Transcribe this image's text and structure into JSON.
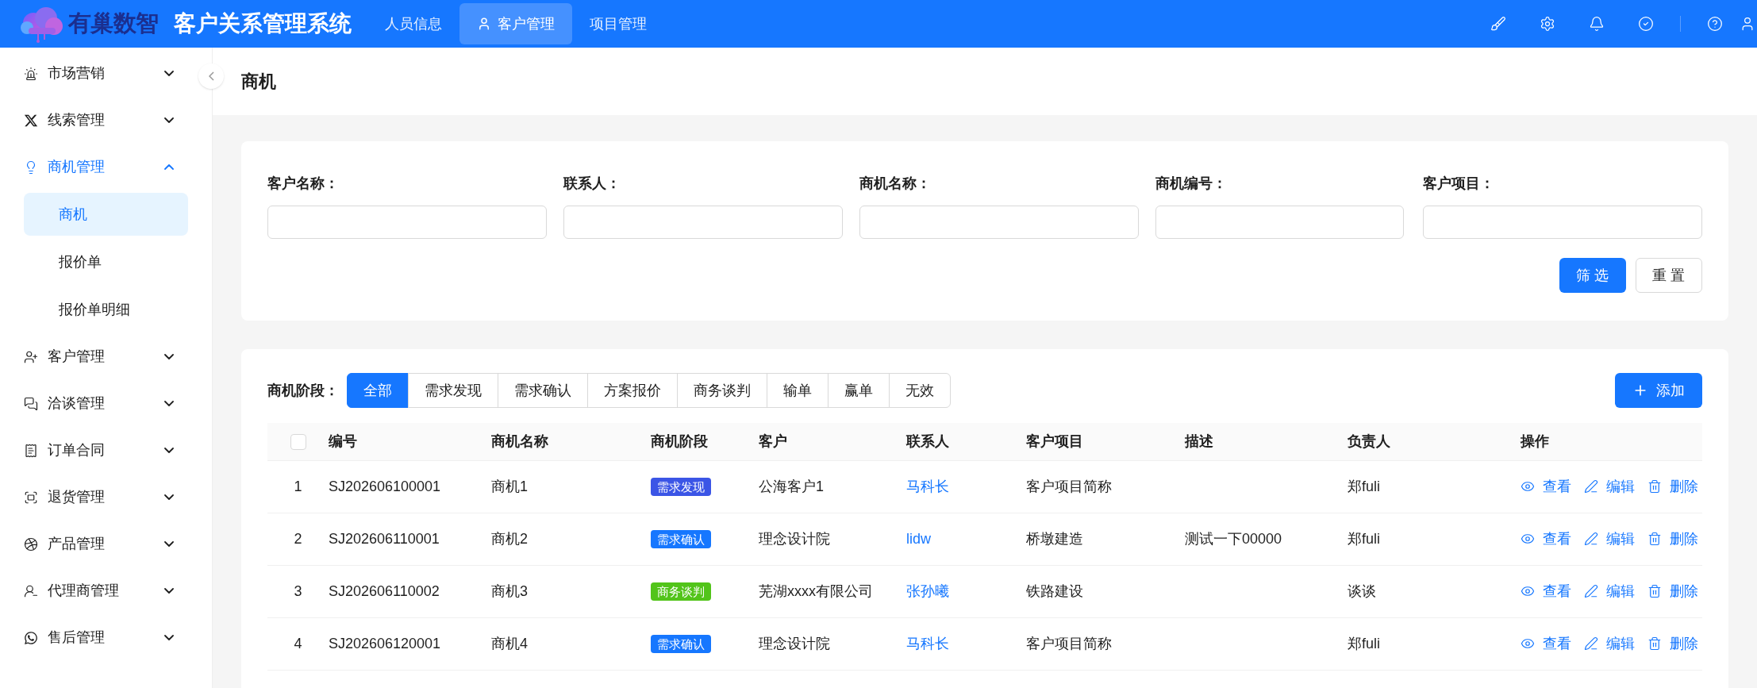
{
  "header": {
    "logo_text": "有巢数智",
    "title": "客户关系管理系统",
    "nav": [
      {
        "label": "人员信息",
        "selected": false
      },
      {
        "label": "客户管理",
        "selected": true
      },
      {
        "label": "项目管理",
        "selected": false
      }
    ]
  },
  "sidebar": {
    "items": [
      {
        "label": "市场营销",
        "expanded": false
      },
      {
        "label": "线索管理",
        "expanded": false
      },
      {
        "label": "商机管理",
        "expanded": true,
        "children": [
          {
            "label": "商机",
            "selected": true
          },
          {
            "label": "报价单",
            "selected": false
          },
          {
            "label": "报价单明细",
            "selected": false
          }
        ]
      },
      {
        "label": "客户管理",
        "expanded": false
      },
      {
        "label": "洽谈管理",
        "expanded": false
      },
      {
        "label": "订单合同",
        "expanded": false
      },
      {
        "label": "退货管理",
        "expanded": false
      },
      {
        "label": "产品管理",
        "expanded": false
      },
      {
        "label": "代理商管理",
        "expanded": false
      },
      {
        "label": "售后管理",
        "expanded": false
      }
    ]
  },
  "page_title": "商机",
  "filters": [
    {
      "label": "客户名称："
    },
    {
      "label": "联系人："
    },
    {
      "label": "商机名称："
    },
    {
      "label": "商机编号："
    },
    {
      "label": "客户项目："
    }
  ],
  "filter_buttons": [
    {
      "label": "筛 选",
      "kind": "primary"
    },
    {
      "label": "重 置",
      "kind": "default"
    }
  ],
  "stage_filter": {
    "label": "商机阶段：",
    "options": [
      {
        "label": "全部",
        "selected": true
      },
      {
        "label": "需求发现",
        "selected": false
      },
      {
        "label": "需求确认",
        "selected": false
      },
      {
        "label": "方案报价",
        "selected": false
      },
      {
        "label": "商务谈判",
        "selected": false
      },
      {
        "label": "输单",
        "selected": false
      },
      {
        "label": "赢单",
        "selected": false
      },
      {
        "label": "无效",
        "selected": false
      }
    ]
  },
  "add_button": "添加",
  "table": {
    "select_all_checked": false,
    "columns": [
      "编号",
      "商机名称",
      "商机阶段",
      "客户",
      "联系人",
      "客户项目",
      "描述",
      "负责人",
      "操作"
    ],
    "rows": [
      {
        "index": "1",
        "code": "SJ202606100001",
        "name": "商机1",
        "stage": "需求发现",
        "color": "#3b55e6",
        "customer": "公海客户1",
        "contact": "马科长",
        "project": "客户项目简称",
        "owner": "郑fuli",
        "actions": [
          "查看",
          "编辑",
          "删除"
        ]
      },
      {
        "index": "2",
        "code": "SJ202606110001",
        "name": "商机2",
        "stage": "需求确认",
        "color": "#1677ff",
        "customer": "理念设计院",
        "contact": "lidw",
        "project": "桥墩建造",
        "description": "测试一下00000",
        "owner": "郑fuli",
        "actions": [
          "查看",
          "编辑",
          "删除"
        ]
      },
      {
        "index": "3",
        "code": "SJ202606110002",
        "name": "商机3",
        "stage": "商务谈判",
        "color": "#52c41a",
        "customer": "芜湖xxxx有限公司",
        "contact": "张孙曦",
        "project": "铁路建设",
        "owner": "谈谈",
        "actions": [
          "查看",
          "编辑",
          "删除"
        ]
      },
      {
        "index": "4",
        "code": "SJ202606120001",
        "name": "商机4",
        "stage": "需求确认",
        "color": "#1677ff",
        "customer": "理念设计院",
        "contact": "马科长",
        "project": "客户项目简称",
        "owner": "郑fuli",
        "actions": [
          "查看",
          "编辑",
          "删除"
        ]
      }
    ]
  }
}
